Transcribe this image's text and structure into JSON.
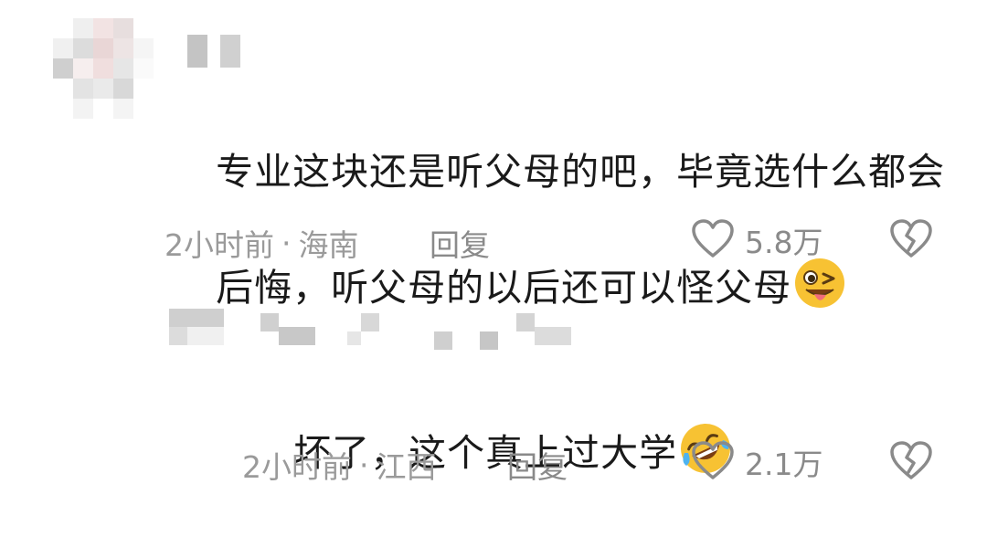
{
  "comments": [
    {
      "text_line1": "专业这块还是听父母的吧，毕竟选什么都会",
      "text_line2": "后悔，听父母的以后还可以怪父母",
      "emoji": "winking-tongue-emoji",
      "time": "2小时前",
      "dot": "·",
      "location": "海南",
      "reply_label": "回复",
      "like_count": "5.8万"
    },
    {
      "text": "坏了，这个真上过大学",
      "emoji": "rolling-laughing-emoji",
      "time": "2小时前",
      "dot": "·",
      "location": "江西",
      "reply_label": "回复",
      "like_count": "2.1万"
    }
  ],
  "icons": {
    "like": "heart-outline-icon",
    "dislike": "broken-heart-icon"
  },
  "colors": {
    "meta_text": "#9a9a9a",
    "comment_text": "#1a1a1a",
    "emoji_yellow": "#f7c233"
  }
}
